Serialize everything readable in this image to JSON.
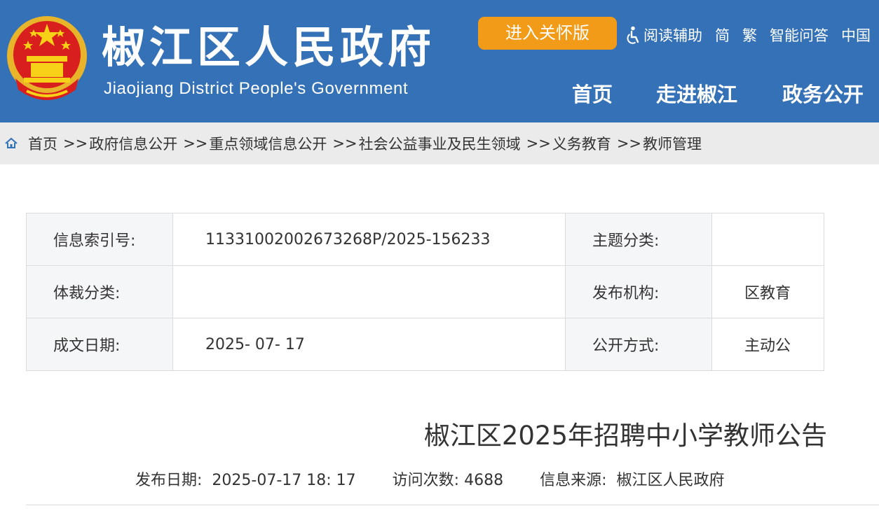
{
  "header": {
    "title": "椒江区人民政府",
    "subtitle": "Jiaojiang District People's Government",
    "care_button": "进入关怀版",
    "top_links": [
      "阅读辅助",
      "简",
      "繁",
      "智能问答",
      "中国"
    ],
    "nav": [
      "首页",
      "走进椒江",
      "政务公开"
    ],
    "colors": {
      "header_bg": "#3471b6",
      "care_button_bg": "#f29b18"
    }
  },
  "breadcrumb": {
    "items": [
      "首页",
      "政府信息公开",
      "重点领域信息公开",
      "社会公益事业及民生领域",
      "义务教育",
      "教师管理"
    ],
    "separator": ">>"
  },
  "info_table": {
    "rows": [
      {
        "label1": "信息索引号:",
        "value1": "11331002002673268P/2025-156233",
        "label2": "主题分类:",
        "value2": ""
      },
      {
        "label1": "体裁分类:",
        "value1": "",
        "label2": "发布机构:",
        "value2": "区教育"
      },
      {
        "label1": "成文日期:",
        "value1": "2025- 07- 17",
        "label2": "公开方式:",
        "value2": "主动公"
      }
    ]
  },
  "article": {
    "title": "椒江区2025年招聘中小学教师公告",
    "publish_label": "发布日期:",
    "publish_date": "2025-07-17 18: 17",
    "visits_label": "访问次数:",
    "visits": "4688",
    "source_label": "信息来源:",
    "source": "椒江区人民政府"
  }
}
